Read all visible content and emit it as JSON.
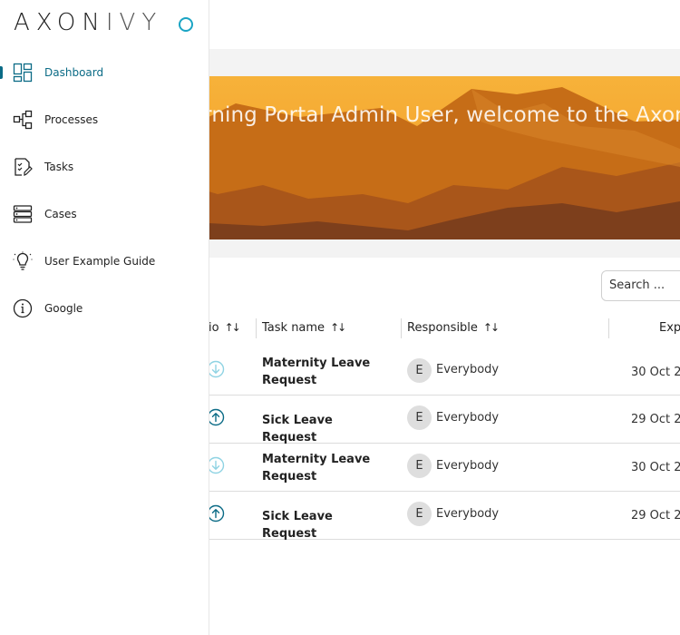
{
  "brand": {
    "logo_text_a": "AXON",
    "logo_text_b": "IVY"
  },
  "sidebar": {
    "items": [
      {
        "label": "Dashboard",
        "icon": "dashboard-icon",
        "active": true
      },
      {
        "label": "Processes",
        "icon": "processes-icon"
      },
      {
        "label": "Tasks",
        "icon": "tasks-icon"
      },
      {
        "label": "Cases",
        "icon": "cases-icon"
      },
      {
        "label": "User Example Guide",
        "icon": "lightbulb-icon"
      },
      {
        "label": "Google",
        "icon": "info-icon"
      }
    ]
  },
  "banner": {
    "welcome": "orning Portal Admin User, welcome to the Axon"
  },
  "search": {
    "placeholder": "Search ..."
  },
  "table": {
    "headers": {
      "priority": "io",
      "task_name": "Task name",
      "responsible": "Responsible",
      "expiry": "Exp"
    },
    "rows": [
      {
        "priority": "low",
        "task_name": "Maternity Leave Request",
        "avatar": "E",
        "responsible": "Everybody",
        "expiry": "30 Oct 2"
      },
      {
        "priority": "high",
        "task_name": "Sick Leave Request",
        "avatar": "E",
        "responsible": "Everybody",
        "expiry": "29 Oct 2"
      },
      {
        "priority": "low",
        "task_name": "Maternity Leave Request",
        "avatar": "E",
        "responsible": "Everybody",
        "expiry": "30 Oct 2"
      },
      {
        "priority": "high",
        "task_name": "Sick Leave Request",
        "avatar": "E",
        "responsible": "Everybody",
        "expiry": "29 Oct 2"
      }
    ]
  },
  "colors": {
    "accent": "#0b6b86",
    "logo_circle": "#1aa4c4",
    "priority_low": "#8fd3e3",
    "priority_high": "#0b6b86"
  }
}
